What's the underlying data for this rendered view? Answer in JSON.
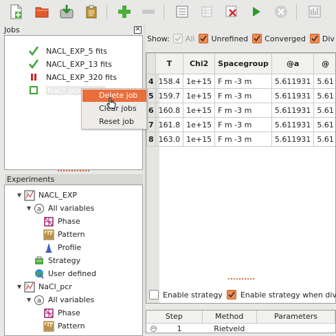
{
  "toolbar": {
    "buttons": [
      {
        "name": "new-project-icon"
      },
      {
        "name": "open-project-icon"
      },
      {
        "name": "save-project-icon"
      },
      {
        "name": "import-icon"
      },
      {
        "name": "add-icon"
      },
      {
        "name": "remove-icon"
      },
      {
        "name": "list-icon"
      },
      {
        "name": "settings-grid-icon"
      },
      {
        "name": "delete-grid-icon"
      },
      {
        "name": "run-icon"
      },
      {
        "name": "stop-icon"
      },
      {
        "name": "plot-icon"
      }
    ]
  },
  "jobs": {
    "title": "Jobs",
    "items": [
      {
        "label": "NACL_EXP_5 fits",
        "status": "converged-icon"
      },
      {
        "label": "NACL_EXP_13 fits",
        "status": "converged-icon"
      },
      {
        "label": "NACL_EXP_320 fits",
        "status": "paused-icon"
      },
      {
        "label": "NaCl_pcr_5 fits",
        "status": "pending-icon"
      }
    ]
  },
  "context_menu": {
    "items": [
      "Delete job",
      "Clear jobs",
      "Reset job"
    ],
    "highlighted": "Delete job"
  },
  "experiments": {
    "title": "Experiments",
    "tree": [
      {
        "label": "NACL_EXP",
        "icon": "experiment-icon",
        "level": 0
      },
      {
        "label": "All variables",
        "icon": "variables-icon",
        "level": 1
      },
      {
        "label": "Phase",
        "icon": "phase-icon",
        "level": 2
      },
      {
        "label": "Pattern",
        "icon": "pattern-icon",
        "level": 2
      },
      {
        "label": "Profile",
        "icon": "profile-icon",
        "level": 2
      },
      {
        "label": "Strategy",
        "icon": "strategy-icon",
        "level": 1
      },
      {
        "label": "User defined",
        "icon": "user-defined-icon",
        "level": 1
      },
      {
        "label": "NaCl_pcr",
        "icon": "experiment-icon",
        "level": 0
      },
      {
        "label": "All variables",
        "icon": "variables-icon",
        "level": 1
      },
      {
        "label": "Phase",
        "icon": "phase-icon",
        "level": 2
      },
      {
        "label": "Pattern",
        "icon": "pattern-icon",
        "level": 2
      }
    ]
  },
  "filters": {
    "show_label": "Show:",
    "all": "All",
    "unrefined": "Unrefined",
    "converged": "Converged",
    "diverged": "Div"
  },
  "table": {
    "headers": [
      "T",
      "Chi2",
      "Spacegroup",
      "@a",
      "@"
    ],
    "rows": [
      {
        "index": "4",
        "cells": [
          "158.4",
          "1e+15",
          "F m -3 m",
          "5.611931",
          "5.61"
        ]
      },
      {
        "index": "5",
        "cells": [
          "159.7",
          "1e+15",
          "F m -3 m",
          "5.611931",
          "5.61"
        ]
      },
      {
        "index": "6",
        "cells": [
          "160.8",
          "1e+15",
          "F m -3 m",
          "5.611931",
          "5.61"
        ]
      },
      {
        "index": "7",
        "cells": [
          "161.8",
          "1e+15",
          "F m -3 m",
          "5.611931",
          "5.61"
        ]
      },
      {
        "index": "8",
        "cells": [
          "163.0",
          "1e+15",
          "F m -3 m",
          "5.611931",
          "5.61"
        ]
      }
    ]
  },
  "strategy": {
    "enable": "Enable strategy",
    "enable_diverged": "Enable strategy when div",
    "headers": [
      "Step",
      "Method",
      "Parameters"
    ],
    "rows": [
      {
        "step": "1",
        "method": "Rietveld"
      }
    ]
  },
  "colors": {
    "accent": "#e86f3b",
    "check_green": "#3aa535",
    "pause_red": "#cc2222"
  }
}
